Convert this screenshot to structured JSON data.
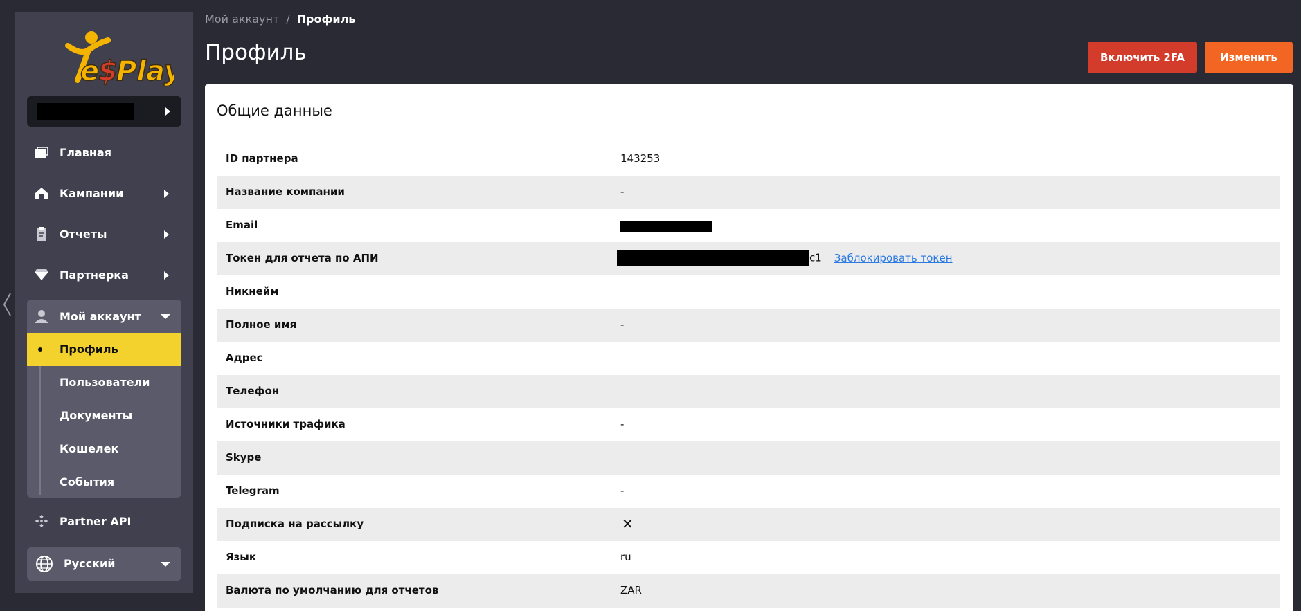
{
  "sidebar": {
    "logo_text": "Ye$Play",
    "account_selector": "",
    "items": [
      {
        "label": "Главная",
        "icon": "cards-icon"
      },
      {
        "label": "Кампании",
        "icon": "home-icon"
      },
      {
        "label": "Отчеты",
        "icon": "clipboard-icon"
      },
      {
        "label": "Партнерка",
        "icon": "diamond-icon"
      },
      {
        "label": "Мой аккаунт",
        "icon": "user-icon"
      }
    ],
    "account_sub": [
      {
        "label": "Профиль",
        "active": true
      },
      {
        "label": "Пользователи"
      },
      {
        "label": "Документы"
      },
      {
        "label": "Кошелек"
      },
      {
        "label": "События"
      }
    ],
    "partner_api": "Partner API",
    "language": "Русский"
  },
  "breadcrumb": {
    "parent": "Мой аккаунт",
    "separator": "/",
    "current": "Профиль"
  },
  "page_title": "Профиль",
  "buttons": {
    "enable_2fa": "Включить 2FA",
    "edit": "Изменить"
  },
  "card": {
    "title": "Общие данные",
    "rows": [
      {
        "key": "ID партнера",
        "value": "143253"
      },
      {
        "key": "Название компании",
        "value": "-"
      },
      {
        "key": "Email",
        "value": ""
      },
      {
        "key": "Токен для отчета по АПИ",
        "value": "c1",
        "action": "Заблокировать токен"
      },
      {
        "key": "Никнейм",
        "value": ""
      },
      {
        "key": "Полное имя",
        "value": "-"
      },
      {
        "key": "Адрес",
        "value": ""
      },
      {
        "key": "Телефон",
        "value": ""
      },
      {
        "key": "Источники трафика",
        "value": "-"
      },
      {
        "key": "Skype",
        "value": ""
      },
      {
        "key": "Telegram",
        "value": "-"
      },
      {
        "key": "Подписка на рассылку",
        "value": "✕"
      },
      {
        "key": "Язык",
        "value": "ru"
      },
      {
        "key": "Валюта по умолчанию для отчетов",
        "value": "ZAR"
      }
    ]
  },
  "colors": {
    "background": "#2a2a35",
    "sidebar": "#40404f",
    "active_item": "#f4d22e",
    "btn_2fa": "#d33b2b",
    "btn_edit": "#f26522",
    "link": "#2a7ae2"
  }
}
